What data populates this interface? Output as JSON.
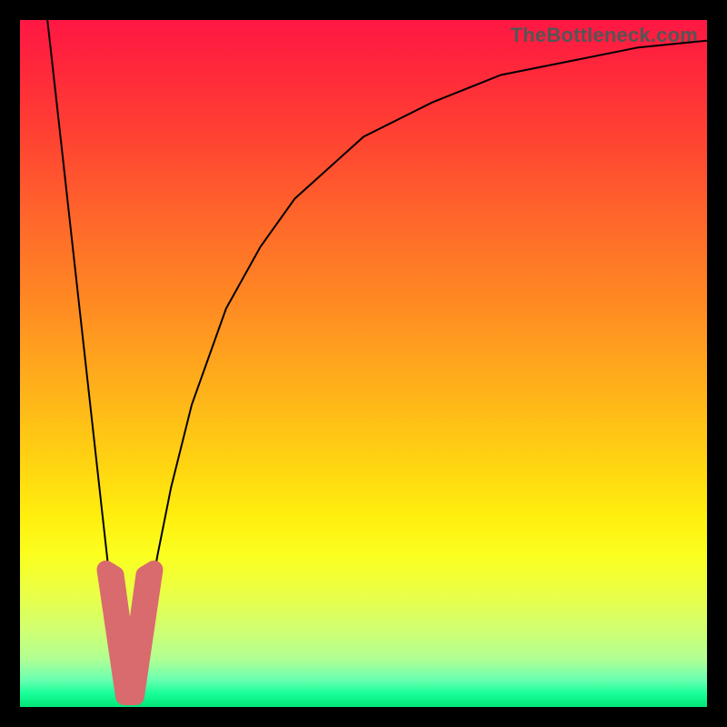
{
  "watermark": "TheBottleneck.com",
  "colors": {
    "curve": "#000000",
    "blob": "#d96a6d",
    "gradient_top": "#ff1744",
    "gradient_bottom": "#00e676",
    "frame": "#000000"
  },
  "chart_data": {
    "type": "line",
    "title": "",
    "xlabel": "",
    "ylabel": "",
    "xlim": [
      0,
      100
    ],
    "ylim": [
      0,
      100
    ],
    "x_optimum": 16,
    "series": [
      {
        "name": "bottleneck-curve",
        "x": [
          4,
          6,
          8,
          10,
          12,
          13,
          14,
          15,
          16,
          17,
          18,
          19,
          20,
          22,
          25,
          30,
          35,
          40,
          50,
          60,
          70,
          80,
          90,
          100
        ],
        "values": [
          100,
          82,
          64,
          46,
          28,
          19,
          12,
          5,
          1,
          4,
          10,
          16,
          22,
          32,
          44,
          58,
          67,
          74,
          83,
          88,
          92,
          94,
          96,
          97
        ]
      }
    ],
    "marker_region": {
      "x_range": [
        12.5,
        19.5
      ],
      "y_range": [
        0,
        20
      ]
    }
  }
}
